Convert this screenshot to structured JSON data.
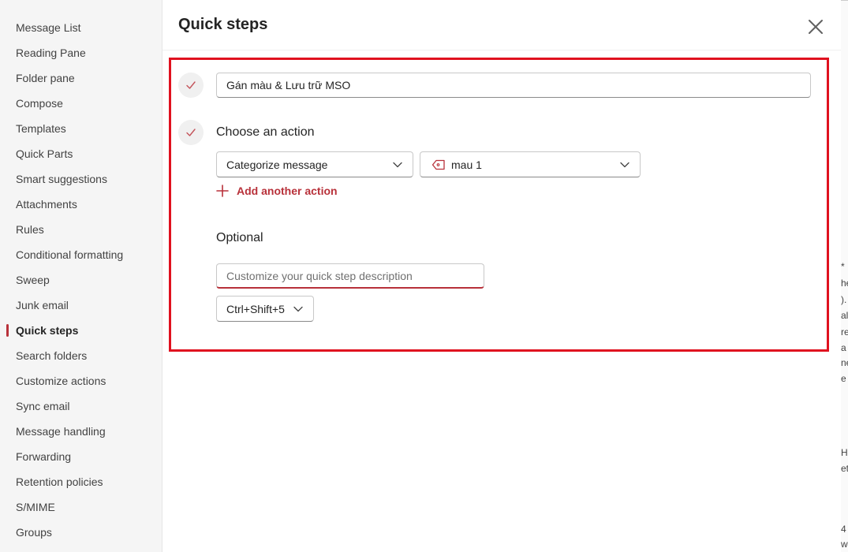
{
  "sidebar": {
    "items": [
      {
        "label": "Message List",
        "active": false
      },
      {
        "label": "Reading Pane",
        "active": false
      },
      {
        "label": "Folder pane",
        "active": false
      },
      {
        "label": "Compose",
        "active": false
      },
      {
        "label": "Templates",
        "active": false
      },
      {
        "label": "Quick Parts",
        "active": false
      },
      {
        "label": "Smart suggestions",
        "active": false
      },
      {
        "label": "Attachments",
        "active": false
      },
      {
        "label": "Rules",
        "active": false
      },
      {
        "label": "Conditional formatting",
        "active": false
      },
      {
        "label": "Sweep",
        "active": false
      },
      {
        "label": "Junk email",
        "active": false
      },
      {
        "label": "Quick steps",
        "active": true
      },
      {
        "label": "Search folders",
        "active": false
      },
      {
        "label": "Customize actions",
        "active": false
      },
      {
        "label": "Sync email",
        "active": false
      },
      {
        "label": "Message handling",
        "active": false
      },
      {
        "label": "Forwarding",
        "active": false
      },
      {
        "label": "Retention policies",
        "active": false
      },
      {
        "label": "S/MIME",
        "active": false
      },
      {
        "label": "Groups",
        "active": false
      }
    ]
  },
  "dialog": {
    "title": "Quick steps",
    "close_icon": "close-icon",
    "step_name": "Gán màu & Lưu trữ MSO",
    "choose_action_label": "Choose an action",
    "action_dropdown": "Categorize message",
    "category_dropdown": "mau 1",
    "add_action_label": "Add another action",
    "optional_label": "Optional",
    "description_placeholder": "Customize your quick step description",
    "shortcut": "Ctrl+Shift+5"
  },
  "background_fragments": [
    "*",
    "he",
    ").",
    "alt",
    "re",
    "a",
    "ne",
    "e",
    "H",
    "et",
    "4",
    "w"
  ],
  "colors": {
    "accent": "#b8313a",
    "highlight_border": "#e0111f",
    "sidebar_bg": "#f5f5f5"
  }
}
